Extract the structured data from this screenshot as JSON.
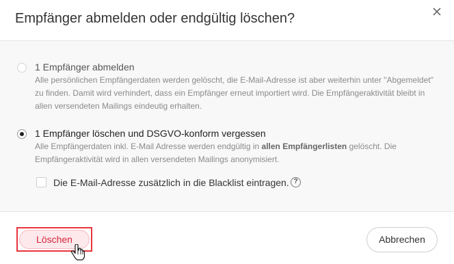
{
  "dialog": {
    "title": "Empfänger abmelden oder endgültig löschen?",
    "close_icon": "close-icon"
  },
  "options": {
    "unsubscribe": {
      "label": "1 Empfänger abmelden",
      "selected": false,
      "description": "Alle persönlichen Empfängerdaten werden gelöscht, die E-Mail-Adresse ist aber weiterhin unter \"Abgemeldet\" zu finden. Damit wird verhindert, dass ein Empfänger erneut importiert wird. Die Empfängeraktivität bleibt in allen versendeten Mailings eindeutig erhalten."
    },
    "delete": {
      "label": "1 Empfänger löschen und DSGVO-konform vergessen",
      "selected": true,
      "description_pre": "Alle Empfängerdaten inkl. E-Mail Adresse werden endgültig in ",
      "description_bold": "allen Empfängerlisten",
      "description_post": " gelöscht. Die Empfängeraktivität wird in allen versendeten Mailings anonymisiert."
    }
  },
  "blacklist": {
    "label": "Die E-Mail-Adresse zusätzlich in die Blacklist eintragen.",
    "checked": false,
    "help_glyph": "?"
  },
  "footer": {
    "delete_label": "Löschen",
    "cancel_label": "Abbrechen"
  },
  "colors": {
    "danger": "#d5243a",
    "danger_bg": "#fde9ec",
    "highlight_border": "#e8343b"
  }
}
